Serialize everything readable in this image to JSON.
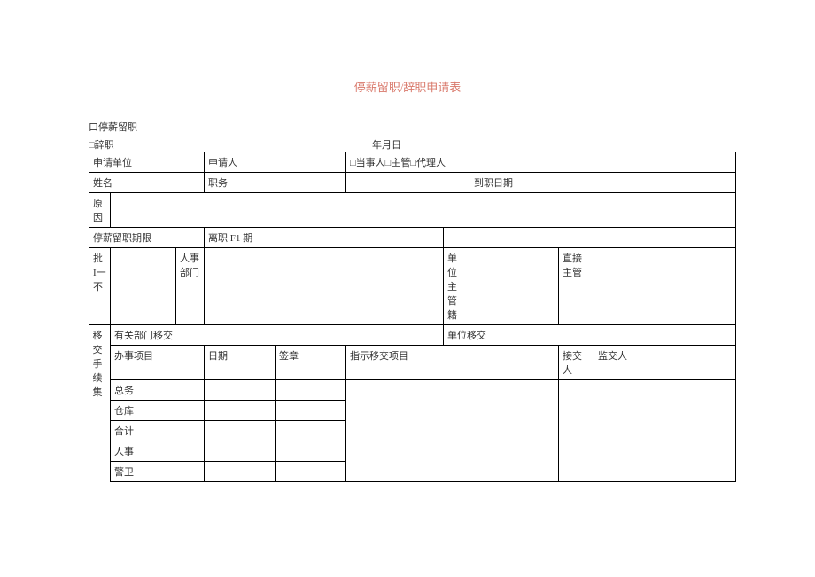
{
  "title": "停薪留职/辞职申请表",
  "checks": {
    "suspend": "口停薪留职",
    "resign": "□辞职",
    "date": "年月日"
  },
  "row1": {
    "apply_unit_label": "申请单位",
    "applicant_label": "申请人",
    "parties_label": "□当事人□主管□代理人"
  },
  "row2": {
    "name_label": "姓名",
    "position_label": "职务",
    "onboard_label": "到职日期"
  },
  "reason_label": "原因",
  "row4": {
    "suspend_period_label": "停薪留职期限",
    "leave_period_label": "离职 F1 期"
  },
  "approval": {
    "side_label": "批\nI一\n不",
    "hr_label": "人事\n部门",
    "unit_mgr_label": "单位\n主管\n籍",
    "direct_mgr_label": "直接\n主管"
  },
  "transfer_header": {
    "dept_transfer": "有关部门移交",
    "unit_transfer": "单位移交"
  },
  "transfer_cols": {
    "project": "办事项目",
    "date": "日期",
    "seal": "签章",
    "instruct": "指示移交项目",
    "receiver": "接交\n人",
    "supervisor": "监交人"
  },
  "side_label": "移交\n手续\n集",
  "rows": {
    "r1": "总务",
    "r2": "仓库",
    "r3": "合计",
    "r4": "人事",
    "r5": "警卫"
  }
}
